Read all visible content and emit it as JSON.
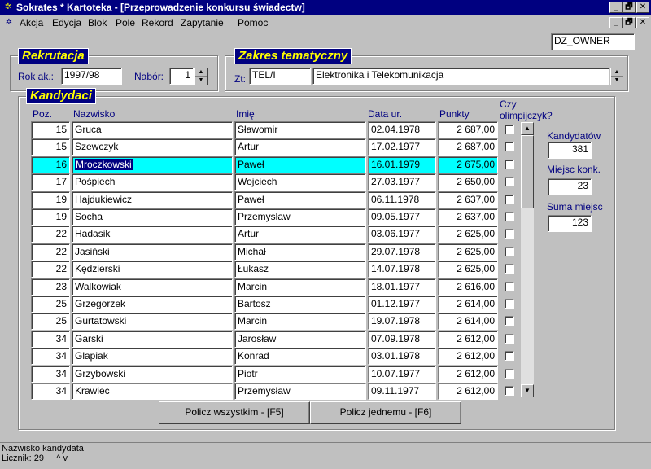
{
  "window": {
    "title": "Sokrates * Kartoteka - [Przeprowadzenie konkursu świadectw]",
    "minimize": "_",
    "restore": "🗗",
    "close": "✕"
  },
  "menu": [
    "Akcja",
    "Edycja",
    "Blok",
    "Pole",
    "Rekord",
    "Zapytanie",
    "Pomoc"
  ],
  "user_field": "DZ_OWNER",
  "rekrutacja": {
    "title": "Rekrutacja",
    "rok_label": "Rok ak.:",
    "rok_value": "1997/98",
    "nabor_label": "Nabór:",
    "nabor_value": "1"
  },
  "zakres": {
    "title": "Zakres tematyczny",
    "zt_label": "Zt:",
    "code": "TEL/I",
    "name": "Elektronika i Telekomunikacja"
  },
  "kandydaci": {
    "title": "Kandydaci",
    "headers": {
      "poz": "Poz.",
      "nazwisko": "Nazwisko",
      "imie": "Imię",
      "data": "Data ur.",
      "punkty": "Punkty",
      "olimp_1": "Czy",
      "olimp_2": "olimpijczyk?"
    },
    "rows": [
      {
        "poz": "15",
        "nazwisko": "Gruca",
        "imie": "Sławomir",
        "data": "02.04.1978",
        "punkty": "2 687,00"
      },
      {
        "poz": "15",
        "nazwisko": "Szewczyk",
        "imie": "Artur",
        "data": "17.02.1977",
        "punkty": "2 687,00"
      },
      {
        "poz": "16",
        "nazwisko": "Mroczkowski",
        "imie": "Paweł",
        "data": "16.01.1979",
        "punkty": "2 675,00"
      },
      {
        "poz": "17",
        "nazwisko": "Pośpiech",
        "imie": "Wojciech",
        "data": "27.03.1977",
        "punkty": "2 650,00"
      },
      {
        "poz": "19",
        "nazwisko": "Hajdukiewicz",
        "imie": "Paweł",
        "data": "06.11.1978",
        "punkty": "2 637,00"
      },
      {
        "poz": "19",
        "nazwisko": "Socha",
        "imie": "Przemysław",
        "data": "09.05.1977",
        "punkty": "2 637,00"
      },
      {
        "poz": "22",
        "nazwisko": "Hadasik",
        "imie": "Artur",
        "data": "03.06.1977",
        "punkty": "2 625,00"
      },
      {
        "poz": "22",
        "nazwisko": "Jasiński",
        "imie": "Michał",
        "data": "29.07.1978",
        "punkty": "2 625,00"
      },
      {
        "poz": "22",
        "nazwisko": "Kędzierski",
        "imie": "Łukasz",
        "data": "14.07.1978",
        "punkty": "2 625,00"
      },
      {
        "poz": "23",
        "nazwisko": "Walkowiak",
        "imie": "Marcin",
        "data": "18.01.1977",
        "punkty": "2 616,00"
      },
      {
        "poz": "25",
        "nazwisko": "Grzegorzek",
        "imie": "Bartosz",
        "data": "01.12.1977",
        "punkty": "2 614,00"
      },
      {
        "poz": "25",
        "nazwisko": "Gurtatowski",
        "imie": "Marcin",
        "data": "19.07.1978",
        "punkty": "2 614,00"
      },
      {
        "poz": "34",
        "nazwisko": "Garski",
        "imie": "Jarosław",
        "data": "07.09.1978",
        "punkty": "2 612,00"
      },
      {
        "poz": "34",
        "nazwisko": "Glapiak",
        "imie": "Konrad",
        "data": "03.01.1978",
        "punkty": "2 612,00"
      },
      {
        "poz": "34",
        "nazwisko": "Grzybowski",
        "imie": "Piotr",
        "data": "10.07.1977",
        "punkty": "2 612,00"
      },
      {
        "poz": "34",
        "nazwisko": "Krawiec",
        "imie": "Przemysław",
        "data": "09.11.1977",
        "punkty": "2 612,00"
      }
    ],
    "selected_index": 2
  },
  "stats": {
    "kandydatow_label": "Kandydatów",
    "kandydatow_value": "381",
    "miejsc_label": "Miejsc konk.",
    "miejsc_value": "23",
    "suma_label": "Suma miejsc",
    "suma_value": "123"
  },
  "buttons": {
    "policz_wszystkim": "Policz wszystkim - [F5]",
    "policz_jednemu": "Policz jednemu - [F6]"
  },
  "status": {
    "line1": "Nazwisko kandydata",
    "line2": "Licznik: 29     ^ v"
  },
  "colors": {
    "title_bg": "#000080",
    "group_title_text": "#ffff00",
    "label_text": "#000080",
    "selected_row": "#00ffff"
  }
}
